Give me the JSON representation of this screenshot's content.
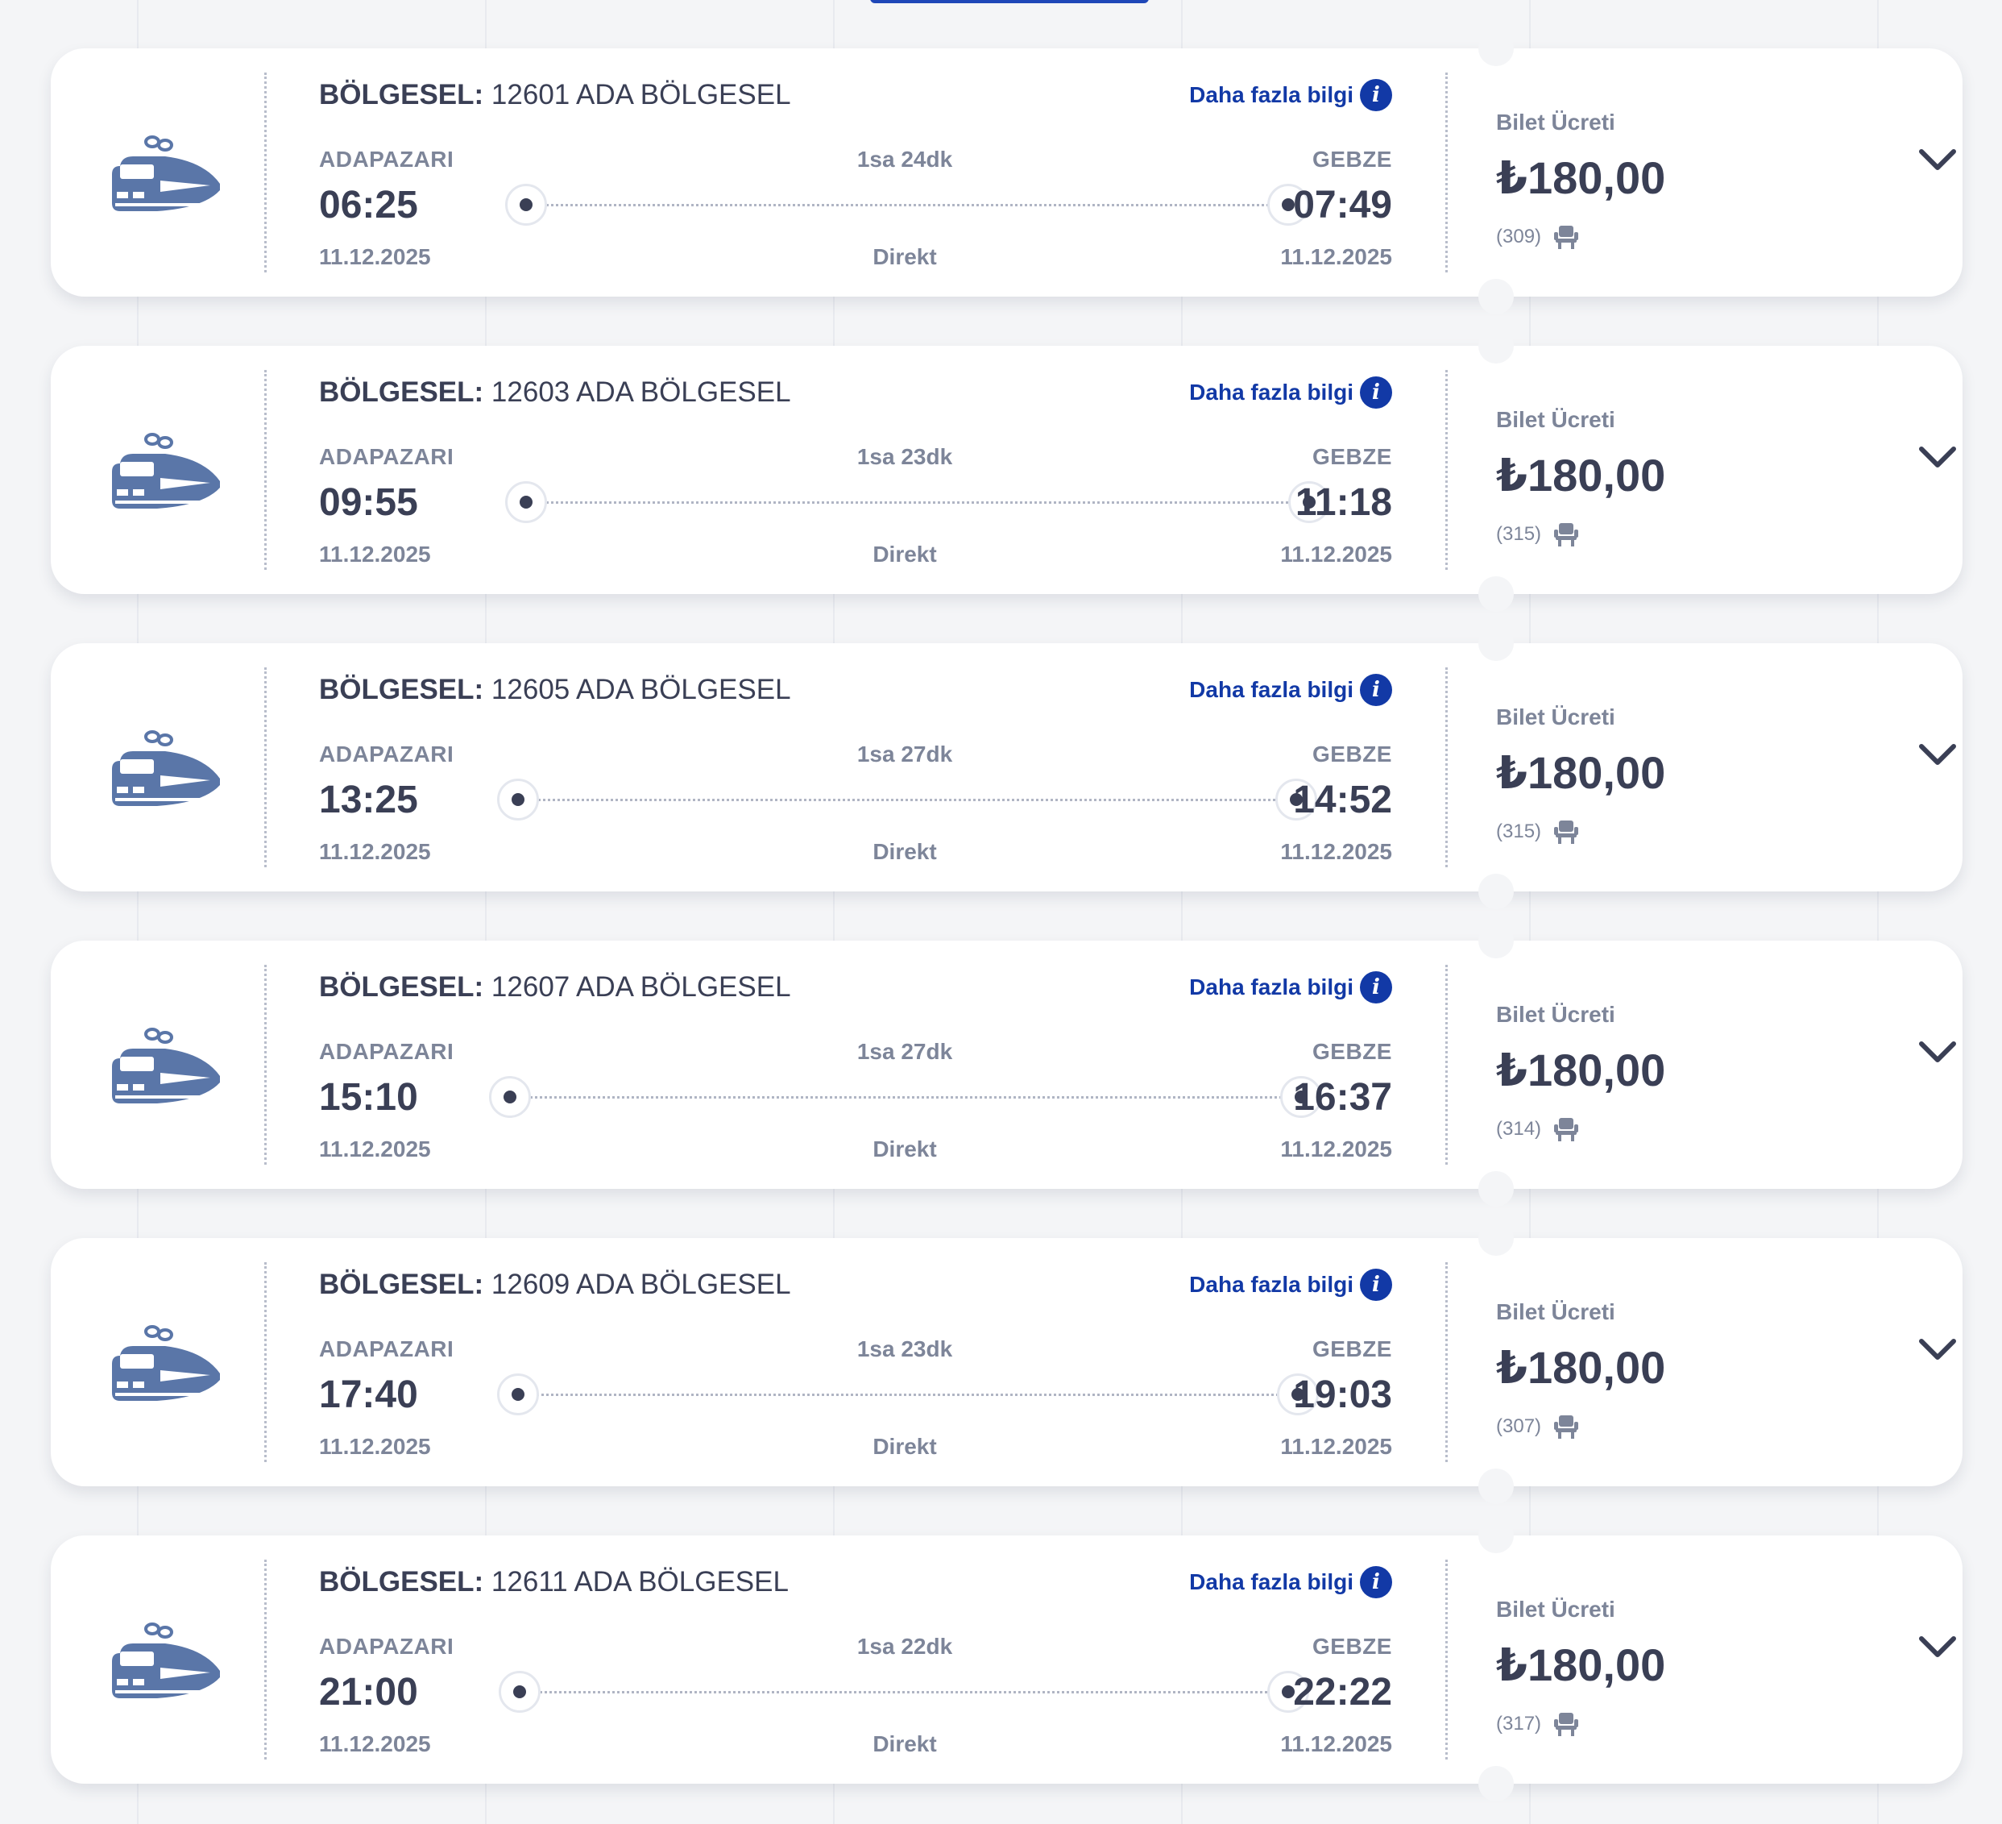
{
  "colors": {
    "accent": "#1239a6",
    "text_dark": "#3a3f55",
    "text_muted": "#7d8599",
    "train_icon": "#5a76a8",
    "background": "#f4f5f7"
  },
  "icons": {
    "train": "train-icon",
    "info": "info-icon",
    "seat": "seat-icon",
    "chevron": "chevron-down-icon"
  },
  "trips": [
    {
      "type_label": "BÖLGESEL:",
      "name": "12601 ADA BÖLGESEL",
      "more_info": "Daha fazla bilgi",
      "info_glyph": "i",
      "from": "ADAPAZARI",
      "to": "GEBZE",
      "duration": "1sa 24dk",
      "dep_time": "06:25",
      "arr_time": "07:49",
      "dep_date": "11.12.2025",
      "arr_date": "11.12.2025",
      "stop_type": "Direkt",
      "price_label": "Bilet Ücreti",
      "price": "₺180,00",
      "seats": "(309)"
    },
    {
      "type_label": "BÖLGESEL:",
      "name": "12603 ADA BÖLGESEL",
      "more_info": "Daha fazla bilgi",
      "info_glyph": "i",
      "from": "ADAPAZARI",
      "to": "GEBZE",
      "duration": "1sa 23dk",
      "dep_time": "09:55",
      "arr_time": "11:18",
      "dep_date": "11.12.2025",
      "arr_date": "11.12.2025",
      "stop_type": "Direkt",
      "price_label": "Bilet Ücreti",
      "price": "₺180,00",
      "seats": "(315)"
    },
    {
      "type_label": "BÖLGESEL:",
      "name": "12605 ADA BÖLGESEL",
      "more_info": "Daha fazla bilgi",
      "info_glyph": "i",
      "from": "ADAPAZARI",
      "to": "GEBZE",
      "duration": "1sa 27dk",
      "dep_time": "13:25",
      "arr_time": "14:52",
      "dep_date": "11.12.2025",
      "arr_date": "11.12.2025",
      "stop_type": "Direkt",
      "price_label": "Bilet Ücreti",
      "price": "₺180,00",
      "seats": "(315)"
    },
    {
      "type_label": "BÖLGESEL:",
      "name": "12607 ADA BÖLGESEL",
      "more_info": "Daha fazla bilgi",
      "info_glyph": "i",
      "from": "ADAPAZARI",
      "to": "GEBZE",
      "duration": "1sa 27dk",
      "dep_time": "15:10",
      "arr_time": "16:37",
      "dep_date": "11.12.2025",
      "arr_date": "11.12.2025",
      "stop_type": "Direkt",
      "price_label": "Bilet Ücreti",
      "price": "₺180,00",
      "seats": "(314)"
    },
    {
      "type_label": "BÖLGESEL:",
      "name": "12609 ADA BÖLGESEL",
      "more_info": "Daha fazla bilgi",
      "info_glyph": "i",
      "from": "ADAPAZARI",
      "to": "GEBZE",
      "duration": "1sa 23dk",
      "dep_time": "17:40",
      "arr_time": "19:03",
      "dep_date": "11.12.2025",
      "arr_date": "11.12.2025",
      "stop_type": "Direkt",
      "price_label": "Bilet Ücreti",
      "price": "₺180,00",
      "seats": "(307)"
    },
    {
      "type_label": "BÖLGESEL:",
      "name": "12611 ADA BÖLGESEL",
      "more_info": "Daha fazla bilgi",
      "info_glyph": "i",
      "from": "ADAPAZARI",
      "to": "GEBZE",
      "duration": "1sa 22dk",
      "dep_time": "21:00",
      "arr_time": "22:22",
      "dep_date": "11.12.2025",
      "arr_date": "11.12.2025",
      "stop_type": "Direkt",
      "price_label": "Bilet Ücreti",
      "price": "₺180,00",
      "seats": "(317)"
    }
  ]
}
